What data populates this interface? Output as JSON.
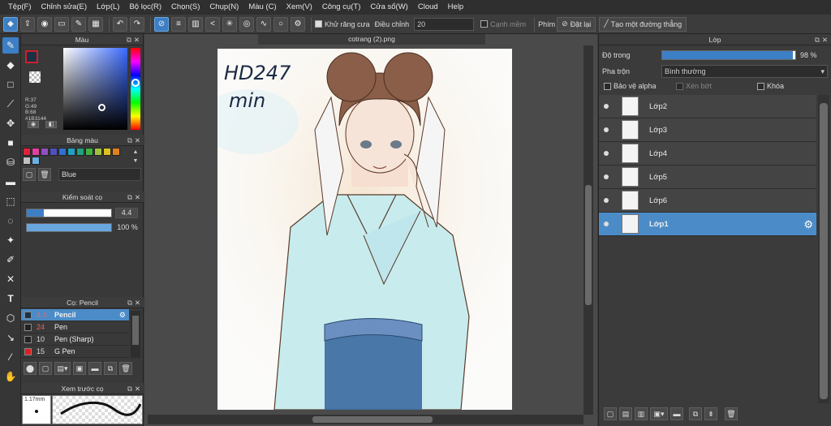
{
  "menu": [
    "Tệp(F)",
    "Chỉnh sửa(E)",
    "Lớp(L)",
    "Bộ lọc(R)",
    "Chọn(S)",
    "Chụp(N)",
    "Màu (C)",
    "Xem(V)",
    "Công cụ(T)",
    "Cửa sổ(W)",
    "Cloud",
    "Help"
  ],
  "toolbar": {
    "antialias_label": "Khử răng cưa",
    "adjust_label": "Điều chỉnh",
    "adjust_value": "20",
    "soft_edge_label": "Cạnh mềm",
    "key_label": "Phím",
    "reset_label": "Đặt lại",
    "line_label": "Tạo một đường thẳng"
  },
  "color_panel": {
    "title": "Màu",
    "r": "R:37",
    "g": "G:49",
    "b": "B:68",
    "hex": "#1B3144"
  },
  "palette_panel": {
    "title": "Bảng màu",
    "name": "Blue",
    "swatches": [
      "#e02040",
      "#e040a0",
      "#9050c0",
      "#5050c0",
      "#3070d0",
      "#20a0c0",
      "#20a080",
      "#40b040",
      "#a0c040",
      "#e0c020",
      "#e08020",
      "#c0c0c0",
      "#6ab0e0"
    ]
  },
  "brush_control": {
    "title": "Kiểm soát cọ",
    "size": "4.4",
    "opacity": "100 %",
    "size_fill": 0.2,
    "opacity_fill": 1.0
  },
  "brush_panel": {
    "title": "Cọ: Pencil",
    "brushes": [
      {
        "size": "4.4",
        "name": "Pencil",
        "color": "#1B3144"
      },
      {
        "size": "24",
        "name": "Pen",
        "color": "#222222"
      },
      {
        "size": "10",
        "name": "Pen (Sharp)",
        "color": "#222222"
      },
      {
        "size": "15",
        "name": "G Pen",
        "color": "#e02020"
      }
    ]
  },
  "preview_panel": {
    "title": "Xem trước cọ",
    "size_label": "1.17mm"
  },
  "document": {
    "tab": "cotrang (2).png",
    "watermark_line1": "HD247",
    "watermark_line2": "min"
  },
  "layers_panel": {
    "title": "Lớp",
    "opacity_label": "Độ trong",
    "opacity_value": "98 %",
    "opacity_fill": 0.98,
    "blend_label": "Pha trộn",
    "blend_value": "Bình thường",
    "protect_alpha": "Bảo vệ alpha",
    "clip": "Xén bớt",
    "lock": "Khóa",
    "layers": [
      "Lớp2",
      "Lớp3",
      "Lớp4",
      "Lớp5",
      "Lớp6",
      "Lớp1"
    ],
    "selected": "Lớp1"
  }
}
